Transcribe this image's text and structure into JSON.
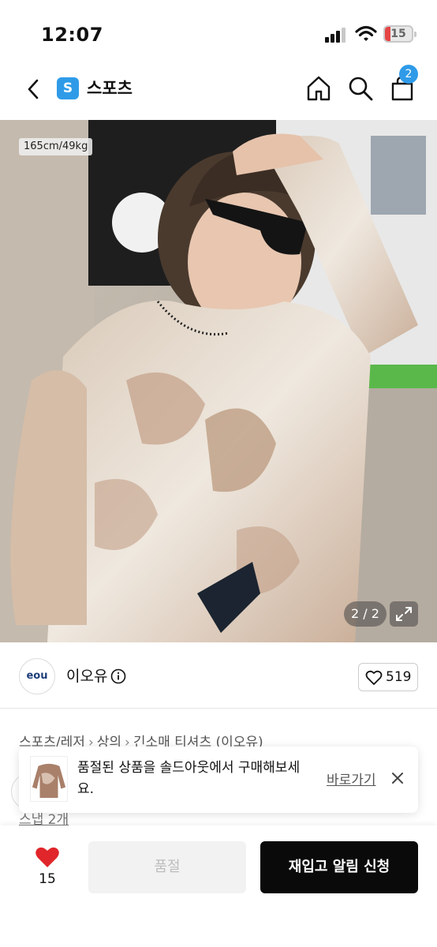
{
  "status_bar": {
    "time": "12:07",
    "battery": "15"
  },
  "nav": {
    "category_badge": "S",
    "title": "스포츠",
    "cart_count": "2"
  },
  "photo": {
    "size_tag": "165cm/49kg",
    "counter": "2 / 2"
  },
  "seller": {
    "logo_text": "eou",
    "name": "이오유",
    "likes": "519"
  },
  "breadcrumb": [
    "스포츠/레저",
    "상의",
    "긴소매 티셔츠 (이오유)"
  ],
  "toast": {
    "message": "품절된 상품을 솔드아웃에서 구매해보세요.",
    "action": "바로가기"
  },
  "peek_text": "스냅 2개",
  "bottom_bar": {
    "like_count": "15",
    "sold_out_label": "품절",
    "restock_label": "재입고 알림 신청"
  },
  "colors": {
    "accent": "#2f9be8",
    "heart": "#e0262b",
    "primary_button": "#0a0a0a"
  }
}
